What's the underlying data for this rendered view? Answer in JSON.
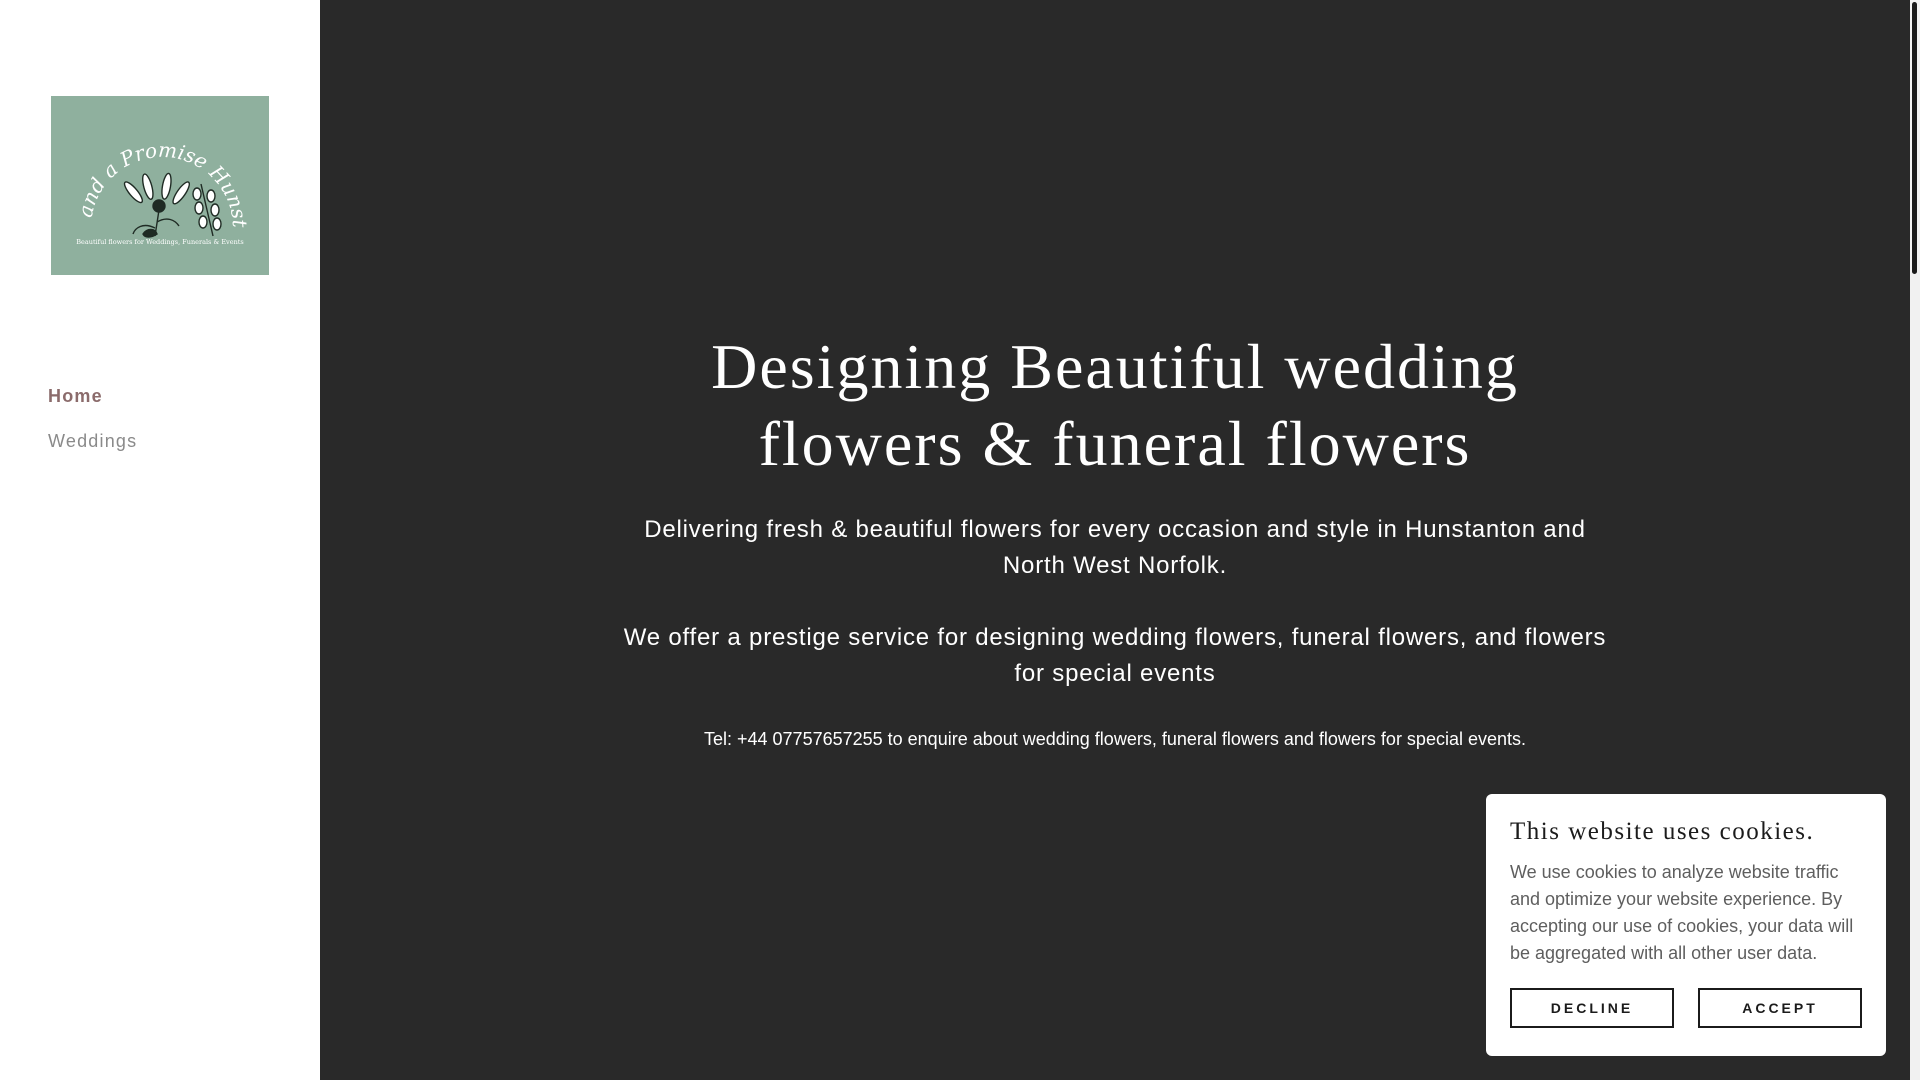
{
  "sidebar": {
    "logo": {
      "title": "Petals and a Promise Hunstanton",
      "tagline": "Beautiful flowers for Weddings, Funerals & Events",
      "background_color": "#8fb09e"
    },
    "nav": [
      {
        "label": "Home",
        "active": true
      },
      {
        "label": "Weddings",
        "active": false
      }
    ]
  },
  "hero": {
    "heading_line1": "Designing Beautiful wedding",
    "heading_line2": "flowers & funeral flowers",
    "subtitle": "Delivering fresh & beautiful flowers for every occasion and style in Hunstanton and North West Norfolk.",
    "subtitle2": "We offer a prestige service for designing wedding flowers, funeral flowers, and flowers for special events",
    "tel_line": "Tel: +44 07757657255 to enquire about wedding flowers, funeral flowers and flowers for special events.",
    "background_color": "#292929"
  },
  "cookie_banner": {
    "title": "This website uses cookies.",
    "body": "We use cookies to analyze website traffic and optimize your website experience. By accepting our use of cookies, your data will be aggregated with all other user data.",
    "decline_label": "DECLINE",
    "accept_label": "ACCEPT"
  },
  "colors": {
    "nav_active": "#8b6b6b",
    "nav_inactive": "#8a8a8a"
  }
}
